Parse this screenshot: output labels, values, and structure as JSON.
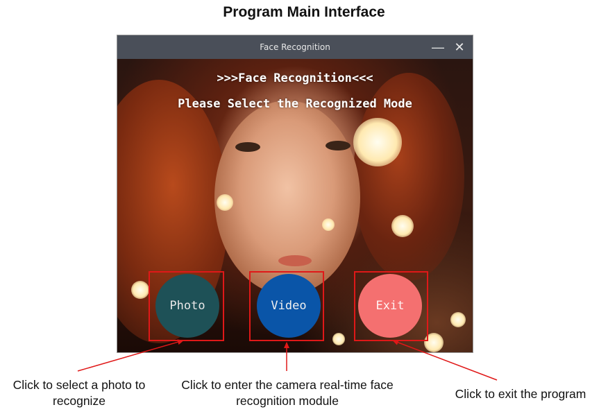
{
  "figure_title": "Program Main Interface",
  "window": {
    "title": "Face Recognition",
    "minimize_glyph": "—",
    "close_glyph": "✕",
    "heading": ">>>Face Recognition<<<",
    "subheading": "Please Select the Recognized Mode"
  },
  "buttons": [
    {
      "label": "Photo",
      "color": "#1e5157",
      "text_color": "#e8e8e8"
    },
    {
      "label": "Video",
      "color": "#0a55a8",
      "text_color": "#f0f0f0"
    },
    {
      "label": "Exit",
      "color": "#f47070",
      "text_color": "#fff3f3"
    }
  ],
  "annotations": {
    "color": "#e01818",
    "photo_caption": "Click to select a photo to recognize",
    "video_caption": "Click to enter the camera real-time face recognition module",
    "exit_caption": "Click to exit the program"
  }
}
